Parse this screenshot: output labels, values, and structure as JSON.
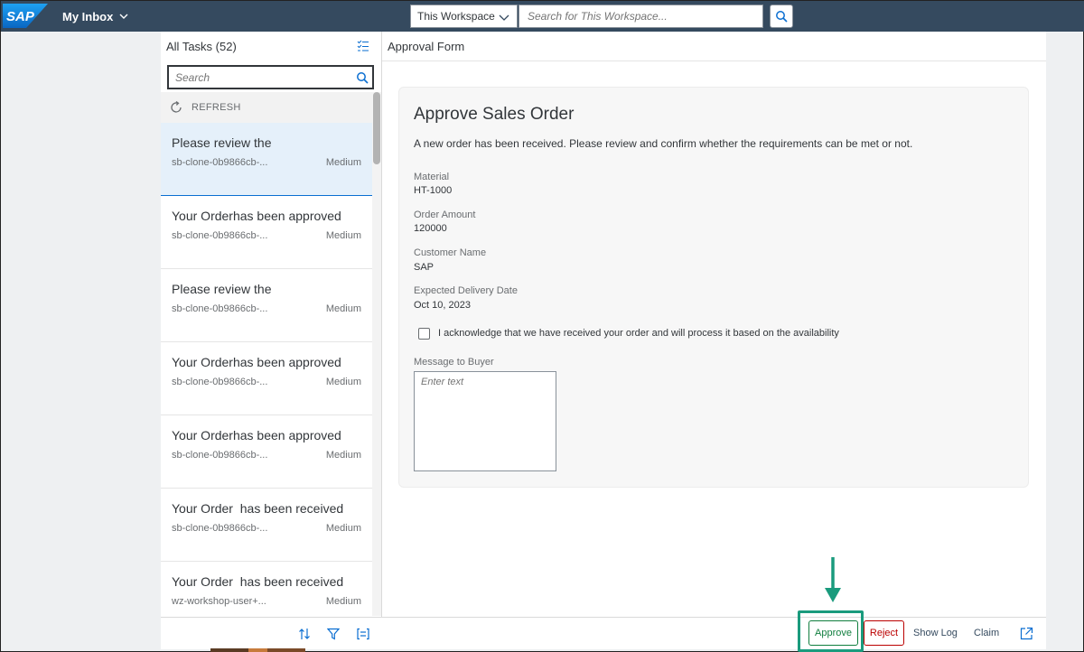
{
  "shell": {
    "logo_text": "SAP",
    "app_title": "My Inbox",
    "workspace_select": "This Workspace",
    "search_placeholder": "Search for This Workspace..."
  },
  "master": {
    "title": "All Tasks (52)",
    "search_placeholder": "Search",
    "refresh_label": "REFRESH",
    "tasks": [
      {
        "title": "Please review the",
        "subtitle": "sb-clone-0b9866cb-...",
        "priority": "Medium",
        "selected": true
      },
      {
        "title": "Your Orderhas been approved",
        "subtitle": "sb-clone-0b9866cb-...",
        "priority": "Medium"
      },
      {
        "title": "Please review the",
        "subtitle": "sb-clone-0b9866cb-...",
        "priority": "Medium"
      },
      {
        "title": "Your Orderhas been approved",
        "subtitle": "sb-clone-0b9866cb-...",
        "priority": "Medium"
      },
      {
        "title": "Your Orderhas been approved",
        "subtitle": "sb-clone-0b9866cb-...",
        "priority": "Medium"
      },
      {
        "title": "Your Order  has been received",
        "subtitle": "sb-clone-0b9866cb-...",
        "priority": "Medium"
      },
      {
        "title": "Your Order  has been received",
        "subtitle": "wz-workshop-user+...",
        "priority": "Medium"
      }
    ]
  },
  "detail": {
    "header": "Approval Form",
    "form": {
      "title": "Approve Sales Order",
      "description": "A new order has been received. Please review and confirm whether the requirements can be met or not.",
      "fields": [
        {
          "label": "Material",
          "value": "HT-1000"
        },
        {
          "label": "Order Amount",
          "value": "120000"
        },
        {
          "label": "Customer Name",
          "value": "SAP"
        },
        {
          "label": "Expected Delivery Date",
          "value": "Oct 10, 2023"
        }
      ],
      "acknowledge_text": "I acknowledge that we have received your order and will process it based on the availability",
      "message_label": "Message to Buyer",
      "message_placeholder": "Enter text"
    },
    "footer": {
      "approve": "Approve",
      "reject": "Reject",
      "show_log": "Show Log",
      "claim": "Claim"
    }
  },
  "colors": {
    "shell": "#354a5f",
    "approve": "#107e3e",
    "reject": "#bb0000",
    "highlight": "#1a9b7d",
    "selected_row": "#e5f0fa"
  }
}
